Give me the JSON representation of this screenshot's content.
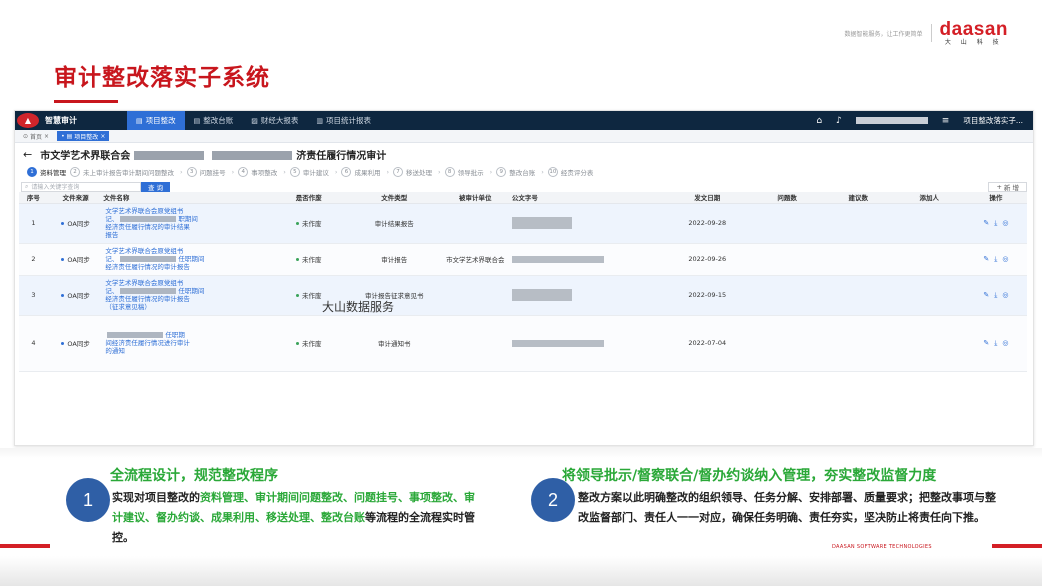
{
  "brand": {
    "tagline": "数据智能服务，让工作更简单",
    "logo_en": "daasan",
    "logo_cn": "大 山 科 技"
  },
  "slide_title": "审计整改落实子系统",
  "app": {
    "name": "智慧审计",
    "nav": [
      {
        "icon": "▤",
        "label": "项目整改",
        "active": true
      },
      {
        "icon": "▤",
        "label": "整改台账",
        "active": false
      },
      {
        "icon": "▨",
        "label": "财经大报表",
        "active": false
      },
      {
        "icon": "▥",
        "label": "项目统计报表",
        "active": false
      }
    ],
    "project_name": "项目整改落实子..."
  },
  "tabs": [
    {
      "label": "首页",
      "active": false
    },
    {
      "label": "项目整改",
      "active": true
    }
  ],
  "page": {
    "title_prefix": "市文学艺术界联合会",
    "title_suffix": "济责任履行情况审计"
  },
  "steps": [
    {
      "num": "1",
      "label": "资料管理",
      "active": true
    },
    {
      "num": "2",
      "label": "未上审计报告审计期间问题整改",
      "active": false
    },
    {
      "num": "3",
      "label": "问题挂号",
      "active": false
    },
    {
      "num": "4",
      "label": "事项整改",
      "active": false
    },
    {
      "num": "5",
      "label": "审计建议",
      "active": false
    },
    {
      "num": "6",
      "label": "成果利用",
      "active": false
    },
    {
      "num": "7",
      "label": "移送处理",
      "active": false
    },
    {
      "num": "8",
      "label": "领导批示",
      "active": false
    },
    {
      "num": "9",
      "label": "整改台账",
      "active": false
    },
    {
      "num": "10",
      "label": "经责评分表",
      "active": false
    }
  ],
  "toolbar": {
    "search_placeholder": "请输入关键字查询",
    "search_button": "查 询",
    "add_button": "新 增"
  },
  "table": {
    "headers": [
      "序号",
      "文件来源",
      "文件名称",
      "是否作废",
      "文件类型",
      "被审计单位",
      "公文字号",
      "发文日期",
      "问题数",
      "建议数",
      "添加人",
      "操作"
    ],
    "rows": [
      {
        "index": "1",
        "source": "OA同步",
        "name_a": "文学艺术界联合会原党组书",
        "name_b": "记、",
        "name_c": "职期间",
        "name_d": "经济责任履行情况的审计结果",
        "name_e": "报告",
        "void": "未作废",
        "type": "审计结果报告",
        "unit": "",
        "date": "2022-09-28"
      },
      {
        "index": "2",
        "source": "OA同步",
        "name_a": "文学艺术界联合会原党组书",
        "name_b": "记、",
        "name_c": "任职期间",
        "name_d": "经济责任履行情况的审计报告",
        "name_e": "",
        "void": "未作废",
        "type": "审计报告",
        "unit": "市文学艺术界联合会",
        "date": "2022-09-26"
      },
      {
        "index": "3",
        "source": "OA同步",
        "name_a": "文学艺术界联合会原党组书",
        "name_b": "记、",
        "name_c": "任职期间",
        "name_d": "经济责任履行情况的审计报告",
        "name_e": "（征求意见稿）",
        "void": "未作废",
        "type": "审计报告征求意见书",
        "unit": "",
        "date": "2022-09-15"
      },
      {
        "index": "4",
        "source": "OA同步",
        "name_a": "",
        "name_b": "",
        "name_c": "任职期",
        "name_d": "间经济责任履行情况进行审计",
        "name_e": "的通知",
        "void": "未作废",
        "type": "审计通知书",
        "unit": "",
        "date": "2022-07-04"
      }
    ]
  },
  "watermark": "大山数据服务",
  "features": {
    "left": {
      "num": "1",
      "title": "全流程设计，规范整改程序",
      "body_pre": "实现对项目整改的",
      "body_hl": "资料管理、审计期间问题整改、问题挂号、事项整改、审计建议、督办约谈、成果利用、移送处理、整改台账",
      "body_post": "等流程的全流程实时管控。"
    },
    "right": {
      "num": "2",
      "title": "将领导批示/督察联合/督办约谈纳入管理，夯实整改监督力度",
      "body": "整改方案以此明确整改的组织领导、任务分解、安排部署、质量要求；把整改事项与整改监督部门、责任人一一对应，确保任务明确、责任夯实，坚决防止将责任向下推。"
    }
  },
  "footer_copy": "DAASAN SOFTWARE TECHNOLOGIES",
  "colors": {
    "brand_red": "#c8161d",
    "accent_blue": "#2f6fd6",
    "green": "#2aa838",
    "navy": "#0e2740"
  }
}
